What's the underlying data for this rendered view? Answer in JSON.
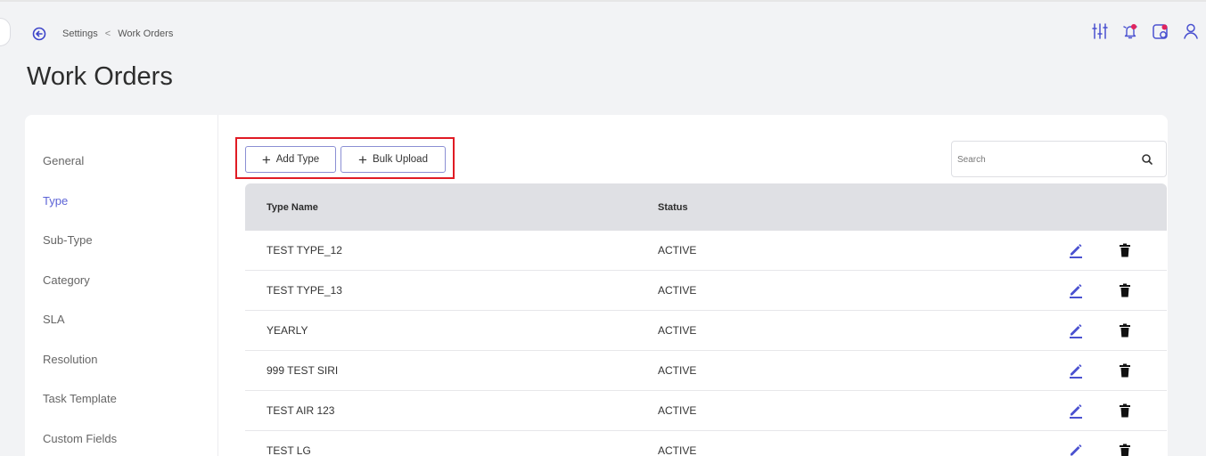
{
  "breadcrumb": {
    "root": "Settings",
    "separator": "<",
    "current": "Work Orders"
  },
  "page": {
    "title": "Work Orders"
  },
  "header_icons": [
    "filter-sliders-icon",
    "bell-icon",
    "calendar-badge-icon",
    "user-icon"
  ],
  "sidebar": {
    "items": [
      {
        "label": "General",
        "active": false
      },
      {
        "label": "Type",
        "active": true
      },
      {
        "label": "Sub-Type",
        "active": false
      },
      {
        "label": "Category",
        "active": false
      },
      {
        "label": "SLA",
        "active": false
      },
      {
        "label": "Resolution",
        "active": false
      },
      {
        "label": "Task Template",
        "active": false
      },
      {
        "label": "Custom Fields",
        "active": false
      }
    ]
  },
  "toolbar": {
    "add_type_label": "Add Type",
    "bulk_upload_label": "Bulk Upload"
  },
  "search": {
    "placeholder": "Search",
    "value": ""
  },
  "table": {
    "columns": [
      "Type Name",
      "Status"
    ],
    "rows": [
      {
        "name": "TEST TYPE_12",
        "status": "ACTIVE"
      },
      {
        "name": "TEST TYPE_13",
        "status": "ACTIVE"
      },
      {
        "name": "YEARLY",
        "status": "ACTIVE"
      },
      {
        "name": "999 TEST SIRI",
        "status": "ACTIVE"
      },
      {
        "name": "TEST AIR 123",
        "status": "ACTIVE"
      },
      {
        "name": "TEST LG",
        "status": "ACTIVE"
      }
    ]
  },
  "colors": {
    "accent": "#5c63d6",
    "highlight_border": "#e01b24",
    "notification_dot": "#e0245e",
    "header_bg": "#dfe0e4"
  }
}
